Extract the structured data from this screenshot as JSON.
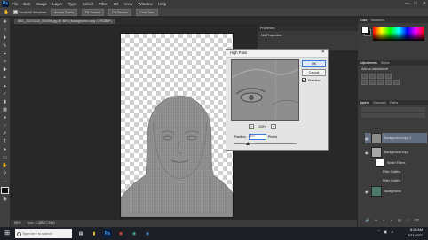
{
  "app": {
    "logo": "Ps"
  },
  "menubar": {
    "items": [
      "File",
      "Edit",
      "Image",
      "Layer",
      "Type",
      "Select",
      "Filter",
      "3D",
      "View",
      "Window",
      "Help"
    ]
  },
  "options": {
    "scroll_all": "Scroll All Windows",
    "actual_pixels": "Actual Pixels",
    "fit_screen": "Fit Screen",
    "fill_screen": "Fill Screen",
    "print_size": "Print Size"
  },
  "document": {
    "tab": "IMG_20210218_000496.jpg @ 58% (Background copy 2, RGB/8*)",
    "status": "Doc: 2.48M/7.94M"
  },
  "properties": {
    "title": "Properties",
    "subtitle": "No Properties"
  },
  "dialog": {
    "title": "High Pass",
    "ok": "OK",
    "cancel": "Cancel",
    "preview": "Preview",
    "zoom": "100%",
    "radius_label": "Radius:",
    "radius_value": "2.0",
    "radius_unit": "Pixels",
    "radius": 2.0
  },
  "right_panels": {
    "color_tabs": [
      "Color",
      "Swatches"
    ],
    "adj_tabs": [
      "Adjustments",
      "Styles"
    ],
    "adj_title": "Add an adjustment",
    "layer_tabs": [
      "Layers",
      "Channels",
      "Paths"
    ],
    "layers": [
      {
        "name": "Background copy 2",
        "selected": true
      },
      {
        "name": "Background copy",
        "selected": false
      },
      {
        "name": "Smart Filters",
        "selected": false
      },
      {
        "name": "Filter Gallery",
        "selected": false
      },
      {
        "name": "Filter Gallery",
        "selected": false
      },
      {
        "name": "Background",
        "selected": false
      }
    ]
  },
  "taskbar": {
    "search_placeholder": "Type here to search",
    "time": "8:28 AM",
    "date": "3/21/2021"
  },
  "colors": {
    "accent": "#3a7bd5",
    "bg": "#282828",
    "panel": "#3c3c3c"
  }
}
